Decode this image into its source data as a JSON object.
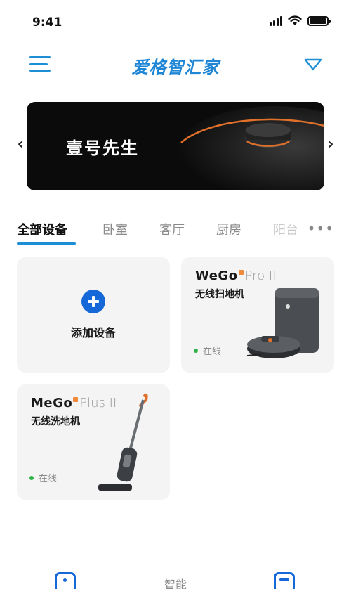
{
  "status_bar": {
    "time": "9:41"
  },
  "header": {
    "title": "爱格智汇家"
  },
  "banner": {
    "text": "壹号先生",
    "prev_arrow": "‹",
    "next_arrow": "›"
  },
  "tabs": {
    "items": [
      {
        "label": "全部设备",
        "active": true
      },
      {
        "label": "卧室",
        "active": false
      },
      {
        "label": "客厅",
        "active": false
      },
      {
        "label": "厨房",
        "active": false
      },
      {
        "label": "阳台",
        "active": false
      }
    ],
    "more": "•••"
  },
  "devices": {
    "add": {
      "label": "添加设备"
    },
    "items": [
      {
        "brand": "WeGo",
        "model": "Pro II",
        "name": "无线扫地机",
        "status": "在线"
      },
      {
        "brand": "MeGo",
        "model": "Plus II",
        "name": "无线洗地机",
        "status": "在线"
      }
    ]
  },
  "bottom_nav": {
    "center_label": "智能"
  },
  "colors": {
    "accent": "#1e8fd6",
    "add_button": "#1668d9",
    "online": "#2fb24a",
    "brand_mark": "#f08a3a",
    "card_bg": "#f4f4f4"
  },
  "icons": [
    "menu-icon",
    "home-icon",
    "chevron-left-icon",
    "chevron-right-icon",
    "plus-icon",
    "more-icon"
  ]
}
